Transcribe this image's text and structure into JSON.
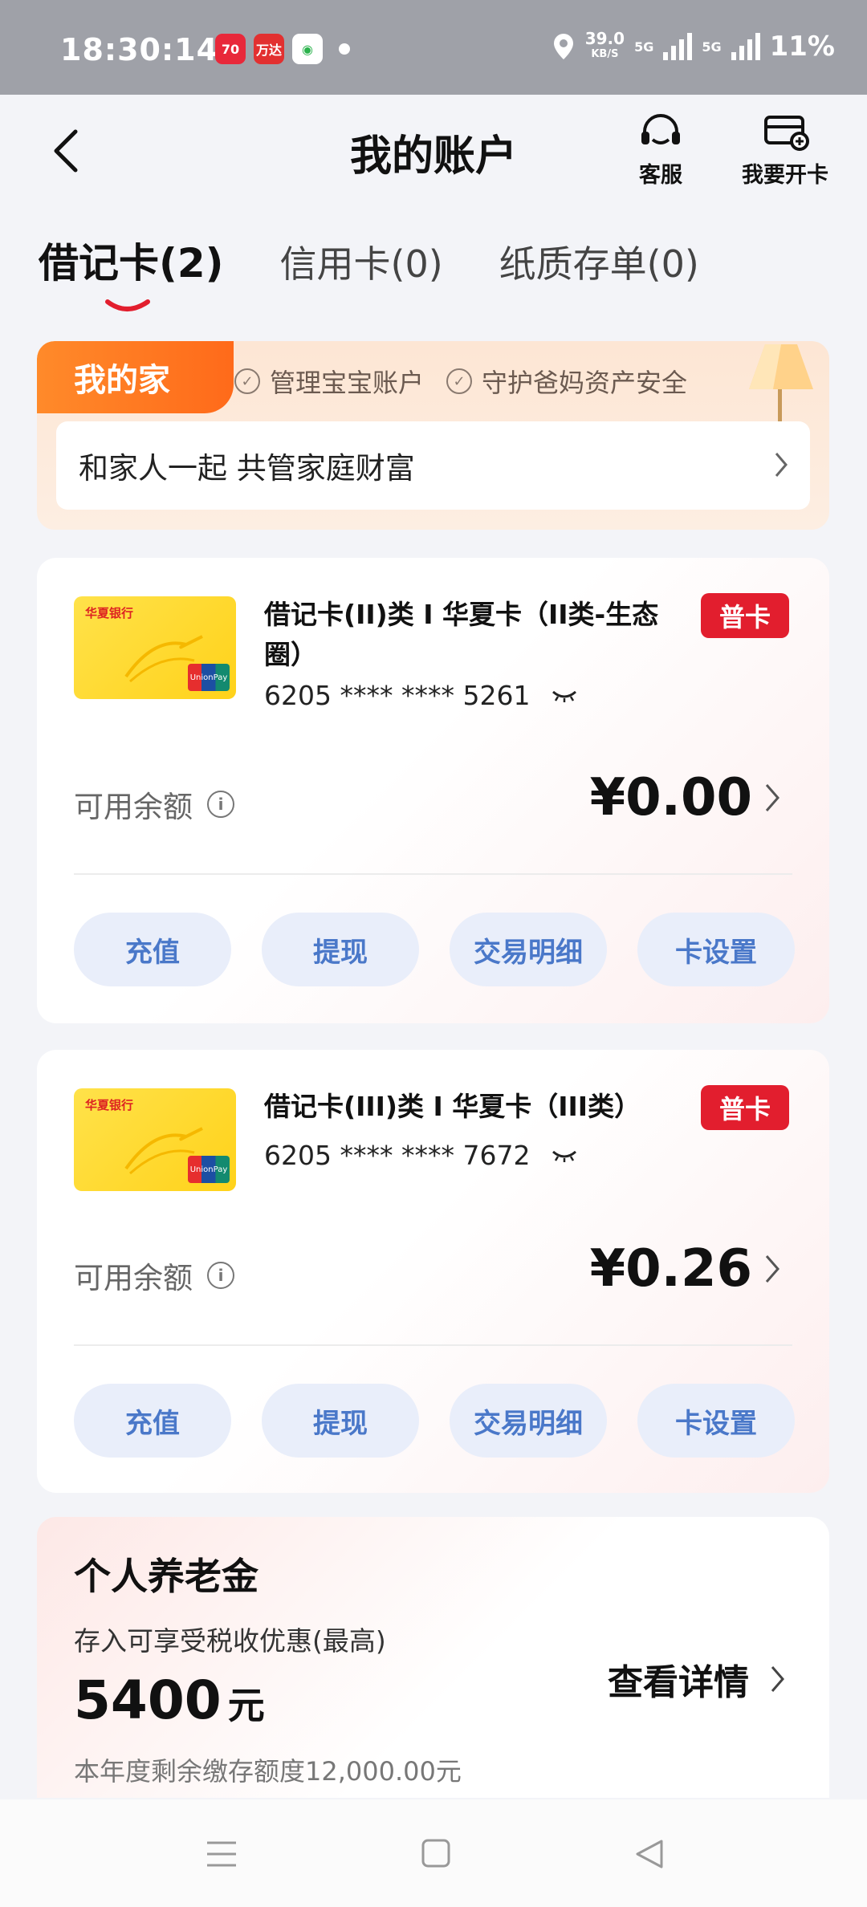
{
  "status_bar": {
    "time": "18:30:14",
    "apps": [
      "70",
      "万达",
      "◉"
    ],
    "speed_value": "39.0",
    "speed_unit": "KB/S",
    "net1": "5G",
    "net2": "5G",
    "battery": "11%"
  },
  "header": {
    "title": "我的账户",
    "service_label": "客服",
    "open_card_label": "我要开卡"
  },
  "tabs": [
    {
      "label": "借记卡(2)",
      "active": true
    },
    {
      "label": "信用卡(0)",
      "active": false
    },
    {
      "label": "纸质存单(0)",
      "active": false
    }
  ],
  "family": {
    "tag": "我的家",
    "features": [
      "管理宝宝账户",
      "守护爸妈资产安全"
    ],
    "slogan": "和家人一起 共管家庭财富"
  },
  "cards": [
    {
      "bank_logo": "华夏银行",
      "name": "借记卡(II)类 I 华夏卡（II类-生态圈）",
      "number": "6205 **** **** 5261",
      "badge": "普卡",
      "balance_label": "可用余额",
      "balance": "¥0.00",
      "actions": [
        "充值",
        "提现",
        "交易明细",
        "卡设置"
      ]
    },
    {
      "bank_logo": "华夏银行",
      "name": "借记卡(III)类 I 华夏卡（III类）",
      "number": "6205 **** **** 7672",
      "badge": "普卡",
      "balance_label": "可用余额",
      "balance": "¥0.26",
      "actions": [
        "充值",
        "提现",
        "交易明细",
        "卡设置"
      ]
    }
  ],
  "pension": {
    "title": "个人养老金",
    "subtitle": "存入可享受税收优惠(最高)",
    "amount": "5400",
    "unit": "元",
    "detail_link": "查看详情",
    "quota": "本年度剩余缴存额度12,000.00元"
  },
  "colors": {
    "accent_red": "#e21e2e",
    "action_blue": "#4a78c9",
    "family_orange": "#ff7a22"
  }
}
